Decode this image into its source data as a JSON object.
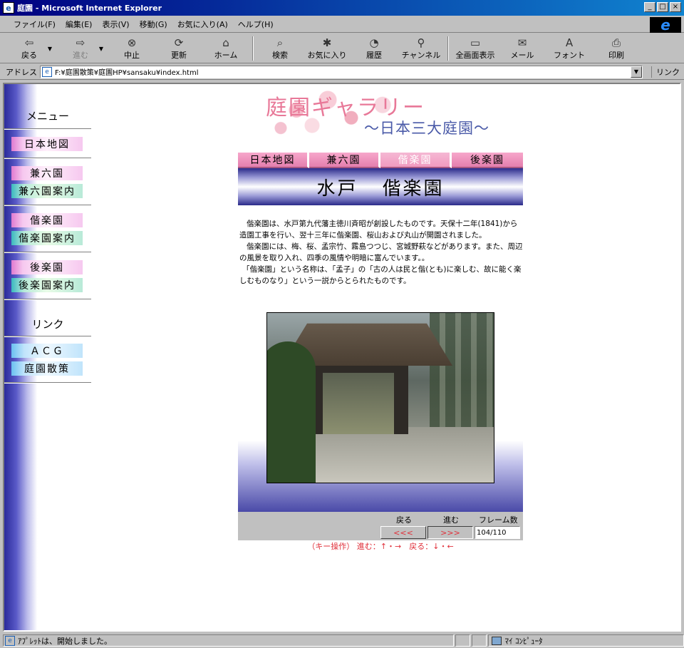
{
  "window": {
    "title": "庭園 - Microsoft Internet Explorer",
    "controls": [
      "_",
      "□",
      "×"
    ]
  },
  "menu": [
    "ファイル(F)",
    "編集(E)",
    "表示(V)",
    "移動(G)",
    "お気に入り(A)",
    "ヘルプ(H)"
  ],
  "toolbar": {
    "back": "戻る",
    "forward": "進む",
    "stop": "中止",
    "refresh": "更新",
    "home": "ホーム",
    "search": "検索",
    "favorites": "お気に入り",
    "history": "履歴",
    "channels": "チャンネル",
    "fullscreen": "全画面表示",
    "mail": "メール",
    "font": "フォント",
    "print": "印刷"
  },
  "address": {
    "label": "アドレス",
    "value": "F:¥庭園散策¥庭園HP¥sansaku¥index.html",
    "links": "リンク"
  },
  "sidebar": {
    "menu_heading": "メニュー",
    "menu_items": [
      {
        "label": "日本地図",
        "style": "pink"
      },
      {
        "label": "兼六園",
        "style": "pink"
      },
      {
        "label": "兼六園案内",
        "style": "green"
      },
      {
        "label": "偕楽園",
        "style": "pink"
      },
      {
        "label": "偕楽園案内",
        "style": "green"
      },
      {
        "label": "後楽園",
        "style": "pink"
      },
      {
        "label": "後楽園案内",
        "style": "green"
      }
    ],
    "link_heading": "リンク",
    "link_items": [
      {
        "label": "ＡＣＧ",
        "style": "blue"
      },
      {
        "label": "庭園散策",
        "style": "blue"
      }
    ]
  },
  "banner": {
    "title": "庭園ギャラリー",
    "subtitle": "～日本三大庭園～"
  },
  "tabs": [
    {
      "label": "日本地図",
      "active": false
    },
    {
      "label": "兼六園",
      "active": false
    },
    {
      "label": "偕楽園",
      "active": true
    },
    {
      "label": "後楽園",
      "active": false
    }
  ],
  "heading": {
    "place": "水戸",
    "garden": "偕楽園"
  },
  "description": [
    "偕楽園は、水戸第九代藩主徳川斉昭が創設したものです。天保十二年(1841)から造園工事を行い、翌十三年に偕楽園、桜山および丸山が開園されました。",
    "偕楽園には、梅、桜、孟宗竹、霧島つつじ、宮城野萩などがあります。また、周辺の風景を取り入れ、四季の風情や明暗に富んでいます。。",
    "「偕楽園」という名称は、「孟子」の「古の人は民と偕(とも)に楽しむ、故に能く楽しむものなり」という一説からとられたものです。"
  ],
  "player": {
    "back_label": "戻る",
    "forward_label": "進む",
    "frames_label": "フレーム数",
    "back_button": "<<<",
    "forward_button": ">>>",
    "frame_value": "104/110",
    "key_hint": "（キー操作） 進む：↑・→　戻る：↓・←"
  },
  "status": {
    "text": "ｱﾌﾟﾚｯﾄは、開始しました。",
    "zone": "ﾏｲ ｺﾝﾋﾟｭｰﾀ"
  },
  "colors": {
    "titlebar_start": "#000080",
    "tab_pink": "#e47fae",
    "heading_navy": "#2a2a8a",
    "control_red": "#e0303a"
  }
}
